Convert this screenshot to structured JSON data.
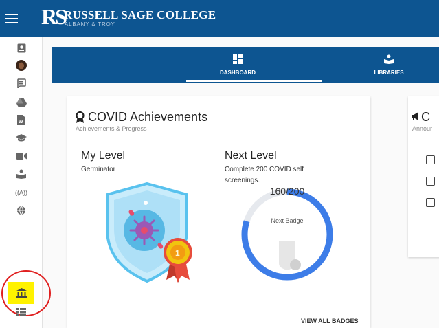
{
  "header": {
    "logo_mark": "RS",
    "title": "RUSSELL SAGE COLLEGE",
    "subtitle": "ALBANY & TROY"
  },
  "tabs": [
    {
      "label": "DASHBOARD",
      "icon": "dashboard-icon",
      "active": true
    },
    {
      "label": "LIBRARIES",
      "icon": "library-reader-icon",
      "active": false
    }
  ],
  "sidebar": {
    "items": [
      {
        "icon": "id-card-icon"
      },
      {
        "icon": "avatar"
      },
      {
        "icon": "chat-icon"
      },
      {
        "icon": "google-drive-icon"
      },
      {
        "icon": "word-document-icon"
      },
      {
        "icon": "graduation-cap-icon"
      },
      {
        "icon": "video-camera-icon"
      },
      {
        "icon": "reading-person-icon"
      },
      {
        "icon": "wireless-access-icon"
      },
      {
        "icon": "globe-icon"
      },
      {
        "icon": "bank-icon"
      },
      {
        "icon": "apps-grid-icon"
      },
      {
        "icon": "expand-icon"
      }
    ],
    "expand_glyph": "»"
  },
  "covid_card": {
    "title": "COVID Achievements",
    "subtitle": "Achievements & Progress",
    "my_level_heading": "My Level",
    "my_level_value": "Germinator",
    "next_level_heading": "Next Level",
    "next_level_desc": "Complete 200 COVID self screenings.",
    "progress_value": "160/200",
    "progress_label": "Next Badge",
    "progress_fraction": 0.8,
    "view_all_label": "VIEW ALL BADGES"
  },
  "announcements_card": {
    "title_partial": "C",
    "subtitle_partial": "Annour"
  },
  "colors": {
    "brand_blue": "#0d5591",
    "progress_blue": "#3d7de8",
    "highlight_yellow": "#fff200",
    "annotation_red": "#e02020"
  }
}
